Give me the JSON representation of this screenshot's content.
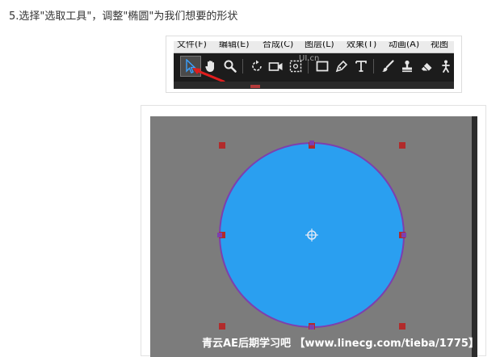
{
  "step_title": "5.选择\"选取工具\"，调整\"椭圆\"为我们想要的形状",
  "toolbar": {
    "menu_items": [
      "文件(F)",
      "编辑(E)",
      "合成(C)",
      "图层(L)",
      "效果(T)",
      "动画(A)",
      "视图"
    ],
    "tools": [
      {
        "icon": "selection-arrow-icon",
        "selected": true
      },
      {
        "icon": "hand-icon"
      },
      {
        "icon": "zoom-icon"
      },
      {
        "icon": "rotate-icon"
      },
      {
        "icon": "camera-icon"
      },
      {
        "icon": "pan-behind-icon"
      },
      {
        "icon": "rectangle-icon"
      },
      {
        "icon": "pen-icon"
      },
      {
        "icon": "text-icon"
      },
      {
        "icon": "brush-icon"
      },
      {
        "icon": "stamp-icon"
      },
      {
        "icon": "eraser-icon"
      },
      {
        "icon": "puppet-icon"
      }
    ],
    "watermark": "UI.cn"
  },
  "canvas": {
    "shape": "ellipse",
    "fill_color": "#2a9ff0",
    "stroke_color": "#7d3fae",
    "handle_color": "#b12b2b",
    "background_color": "#7c7c7c",
    "watermark": "青云AE后期学习吧 【www.linecg.com/tieba/1775】"
  }
}
